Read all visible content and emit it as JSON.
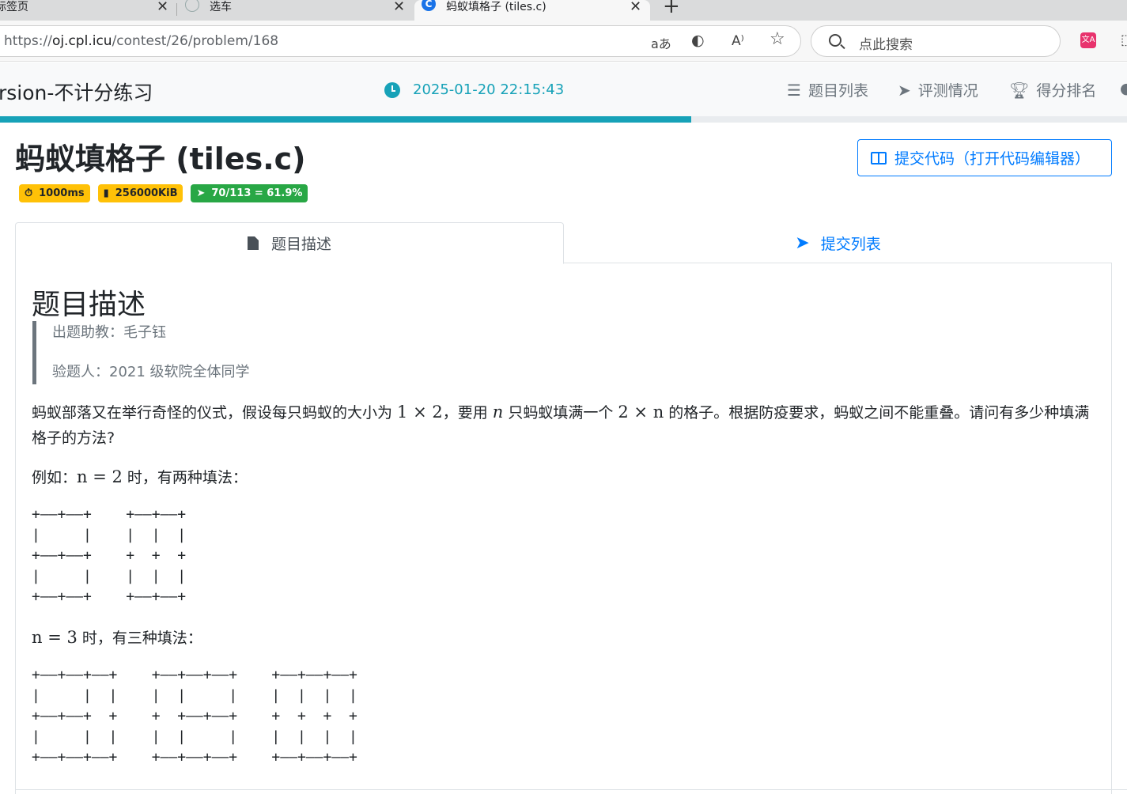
{
  "browser": {
    "tabs": [
      {
        "title": "标签页",
        "close": "✕"
      },
      {
        "title": "选车",
        "close": "✕"
      },
      {
        "title": "蚂蚁填格子 (tiles.c)",
        "close": "✕"
      }
    ],
    "new_tab": "+",
    "url_prefix": "https://",
    "url_host": "oj.cpl.icu",
    "url_path": "/contest/26/problem/168",
    "search_placeholder": "点此搜索",
    "icons": [
      "read-aloud-icon",
      "edge-icon",
      "text-size-icon",
      "favorite-star-icon",
      "translate-icon"
    ]
  },
  "header": {
    "contest_title": "rsion-不计分练习",
    "clock": "2025-01-20 22:15:43",
    "nav": [
      {
        "label": "题目列表",
        "icon": "list-icon"
      },
      {
        "label": "评测情况",
        "icon": "paper-plane-icon"
      },
      {
        "label": "得分排名",
        "icon": "trophy-icon"
      }
    ],
    "progress_fraction": 0.613
  },
  "problem": {
    "title": "蚂蚁填格子 (tiles.c)",
    "badges": {
      "time": "1000ms",
      "memory": "256000KiB",
      "accept": "70/113 = 61.9%"
    },
    "submit_button": "提交代码（打开代码编辑器）",
    "tabs": {
      "description": "题目描述",
      "submissions": "提交列表"
    },
    "section_title": "题目描述",
    "quote": {
      "author": "出题助教：毛子钰",
      "tester": "验题人：2021 级软院全体同学"
    },
    "statement": {
      "p1_a": "蚂蚁部落又在举行奇怪的仪式，假设每只蚂蚁的大小为 ",
      "p1_m1": "1 × 2",
      "p1_b": "，要用 ",
      "p1_m2": "n",
      "p1_c": " 只蚂蚁填满一个 ",
      "p1_m3": "2 × n",
      "p1_d": " 的格子。根据防疫要求，蚂蚁之间不能重叠。请问有多少种填满格子的方法?",
      "p2_a": "例如：",
      "p2_m": "n = 2",
      "p2_b": " 时，有两种填法：",
      "p3_m": "n = 3",
      "p3_b": " 时，有三种填法："
    },
    "ascii_n2": "+——+——+    +——+——+\n|     |    |  |  |\n+——+——+    +  +  +\n|     |    |  |  |\n+——+——+    +——+——+",
    "ascii_n3": "+——+——+——+    +——+——+——+    +——+——+——+\n|     |  |    |  |     |    |  |  |  |\n+——+——+  +    +  +——+——+    +  +  +  +\n|     |  |    |  |     |    |  |  |  |\n+——+——+——+    +——+——+——+    +——+——+——+"
  },
  "colors": {
    "accent": "#17a2b8",
    "link": "#007bff",
    "warning": "#ffc107",
    "success": "#28a745"
  }
}
